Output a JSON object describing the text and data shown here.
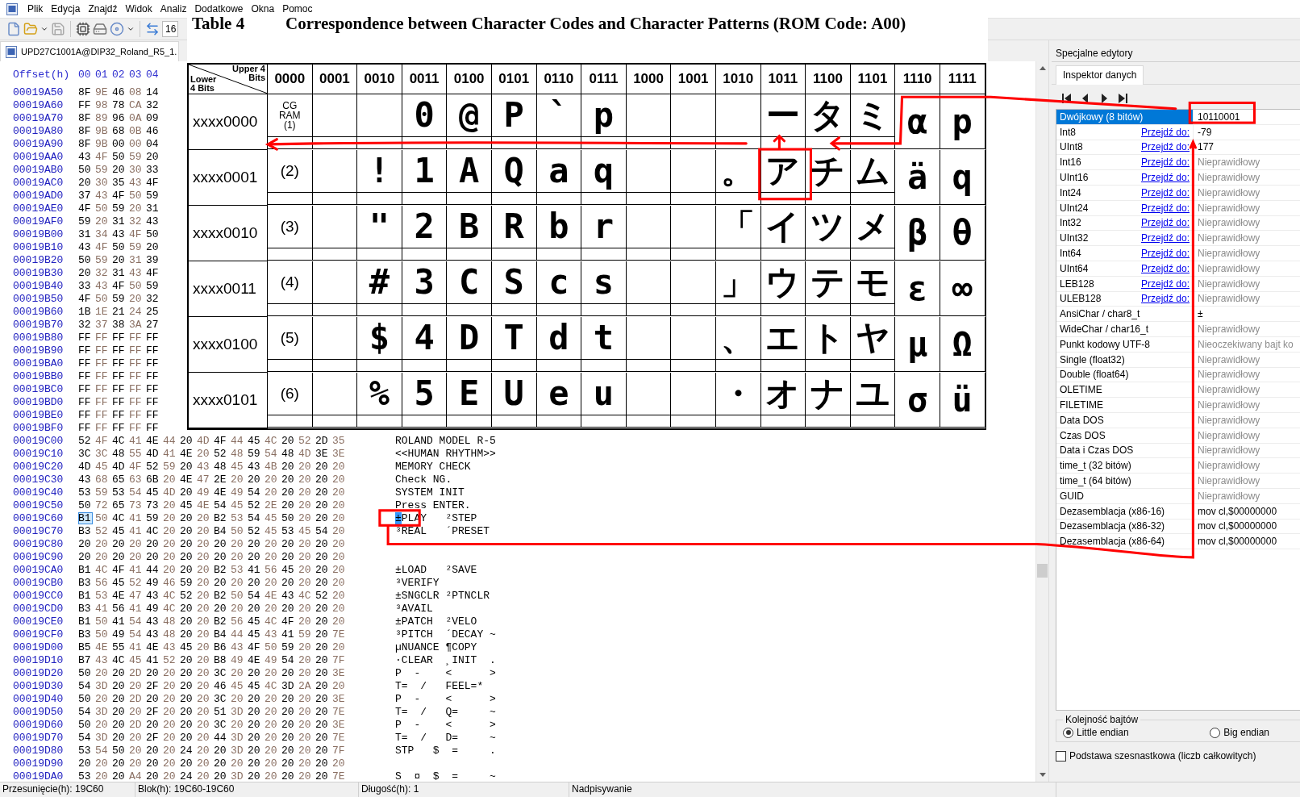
{
  "menu": [
    "Plik",
    "Edycja",
    "Znajdź",
    "Widok",
    "Analiz",
    "Dodatkowe",
    "Okna",
    "Pomoc"
  ],
  "toolbar": {
    "bytes_per_row": "16"
  },
  "file_tab": {
    "title": "UPD27C1001A@DIP32_Roland_R5_1."
  },
  "hex_view": {
    "offset_header": "Offset(h)",
    "columns": [
      "00",
      "01",
      "02",
      "03",
      "04"
    ],
    "rows": [
      {
        "offset": "00019A50",
        "bytes": "8F 9E 46 08 14",
        "selected": false
      },
      {
        "offset": "00019A60",
        "bytes": "FF 98 78 CA 32",
        "selected": false
      },
      {
        "offset": "00019A70",
        "bytes": "8F 89 96 0A 09",
        "selected": false
      },
      {
        "offset": "00019A80",
        "bytes": "8F 9B 68 0B 46",
        "selected": false
      },
      {
        "offset": "00019A90",
        "bytes": "8F 9B 00 00 04",
        "selected": false
      },
      {
        "offset": "00019AA0",
        "bytes": "43 4F 50 59 20",
        "selected": false
      },
      {
        "offset": "00019AB0",
        "bytes": "50 59 20 30 33",
        "selected": false
      },
      {
        "offset": "00019AC0",
        "bytes": "20 30 35 43 4F",
        "selected": false
      },
      {
        "offset": "00019AD0",
        "bytes": "37 43 4F 50 59",
        "selected": false
      },
      {
        "offset": "00019AE0",
        "bytes": "4F 50 59 20 31",
        "selected": false
      },
      {
        "offset": "00019AF0",
        "bytes": "59 20 31 32 43",
        "selected": false
      },
      {
        "offset": "00019B00",
        "bytes": "31 34 43 4F 50",
        "selected": false
      },
      {
        "offset": "00019B10",
        "bytes": "43 4F 50 59 20",
        "selected": false
      },
      {
        "offset": "00019B20",
        "bytes": "50 59 20 31 39",
        "selected": false
      },
      {
        "offset": "00019B30",
        "bytes": "20 32 31 43 4F",
        "selected": false
      },
      {
        "offset": "00019B40",
        "bytes": "33 43 4F 50 59",
        "selected": false
      },
      {
        "offset": "00019B50",
        "bytes": "4F 50 59 20 32",
        "selected": false
      },
      {
        "offset": "00019B60",
        "bytes": "1B 1E 21 24 25",
        "selected": false
      },
      {
        "offset": "00019B70",
        "bytes": "32 37 38 3A 27",
        "selected": false
      },
      {
        "offset": "00019B80",
        "bytes": "FF FF FF FF FF",
        "selected": false
      },
      {
        "offset": "00019B90",
        "bytes": "FF FF FF FF FF",
        "selected": false
      },
      {
        "offset": "00019BA0",
        "bytes": "FF FF FF FF FF",
        "selected": false
      },
      {
        "offset": "00019BB0",
        "bytes": "FF FF FF FF FF",
        "selected": false
      },
      {
        "offset": "00019BC0",
        "bytes": "FF FF FF FF FF",
        "selected": false
      },
      {
        "offset": "00019BD0",
        "bytes": "FF FF FF FF FF",
        "selected": false
      },
      {
        "offset": "00019BE0",
        "bytes": "FF FF FF FF FF",
        "selected": false
      },
      {
        "offset": "00019BF0",
        "bytes": "FF FF FF FF FF",
        "selected": false
      },
      {
        "offset": "00019C00",
        "bytes": "52 4F 4C 41 4E 44 20 4D 4F 44 45 4C 20 52 2D 35",
        "text": "ROLAND MODEL R-5",
        "selected": false
      },
      {
        "offset": "00019C10",
        "bytes": "3C 3C 48 55 4D 41 4E 20 52 48 59 54 48 4D 3E 3E",
        "text": "<<HUMAN RHYTHM>>",
        "selected": false
      },
      {
        "offset": "00019C20",
        "bytes": "4D 45 4D 4F 52 59 20 43 48 45 43 4B 20 20 20 20",
        "text": "MEMORY CHECK",
        "selected": false
      },
      {
        "offset": "00019C30",
        "bytes": "43 68 65 63 6B 20 4E 47 2E 20 20 20 20 20 20 20",
        "text": "Check NG.",
        "selected": false
      },
      {
        "offset": "00019C40",
        "bytes": "53 59 53 54 45 4D 20 49 4E 49 54 20 20 20 20 20",
        "text": "SYSTEM INIT",
        "selected": false
      },
      {
        "offset": "00019C50",
        "bytes": "50 72 65 73 73 20 45 4E 54 45 52 2E 20 20 20 20",
        "text": "Press ENTER.",
        "selected": false
      },
      {
        "offset": "00019C60",
        "bytes": "B1 50 4C 41 59 20 20 20 B2 53 54 45 50 20 20 20",
        "text": "±PLAY   ²STEP",
        "selected": true
      },
      {
        "offset": "00019C70",
        "bytes": "B3 52 45 41 4C 20 20 20 B4 50 52 45 53 45 54 20",
        "text": "³REAL   ´PRESET",
        "selected": false
      },
      {
        "offset": "00019C80",
        "bytes": "20 20 20 20 20 20 20 20 20 20 20 20 20 20 20 20",
        "selected": false
      },
      {
        "offset": "00019C90",
        "bytes": "20 20 20 20 20 20 20 20 20 20 20 20 20 20 20 20",
        "selected": false
      },
      {
        "offset": "00019CA0",
        "bytes": "B1 4C 4F 41 44 20 20 20 B2 53 41 56 45 20 20 20",
        "text": "±LOAD   ²SAVE",
        "selected": false
      },
      {
        "offset": "00019CB0",
        "bytes": "B3 56 45 52 49 46 59 20 20 20 20 20 20 20 20 20",
        "text": "³VERIFY",
        "selected": false
      },
      {
        "offset": "00019CC0",
        "bytes": "B1 53 4E 47 43 4C 52 20 B2 50 54 4E 43 4C 52 20",
        "text": "±SNGCLR ²PTNCLR",
        "selected": false
      },
      {
        "offset": "00019CD0",
        "bytes": "B3 41 56 41 49 4C 20 20 20 20 20 20 20 20 20 20",
        "text": "³AVAIL",
        "selected": false
      },
      {
        "offset": "00019CE0",
        "bytes": "B1 50 41 54 43 48 20 20 B2 56 45 4C 4F 20 20 20",
        "text": "±PATCH  ²VELO",
        "selected": false
      },
      {
        "offset": "00019CF0",
        "bytes": "B3 50 49 54 43 48 20 20 B4 44 45 43 41 59 20 7E",
        "text": "³PITCH  ´DECAY ~",
        "selected": false
      },
      {
        "offset": "00019D00",
        "bytes": "B5 4E 55 41 4E 43 45 20 B6 43 4F 50 59 20 20 20",
        "text": "µNUANCE ¶COPY",
        "selected": false
      },
      {
        "offset": "00019D10",
        "bytes": "B7 43 4C 45 41 52 20 20 B8 49 4E 49 54 20 20 7F",
        "text": "·CLEAR  ¸INIT  .",
        "selected": false
      },
      {
        "offset": "00019D20",
        "bytes": "50 20 20 2D 20 20 20 20 3C 20 20 20 20 20 20 3E",
        "text": "P  -    <      >",
        "selected": false
      },
      {
        "offset": "00019D30",
        "bytes": "54 3D 20 20 2F 20 20 20 46 45 45 4C 3D 2A 20 20",
        "text": "T=  /   FEEL=*",
        "selected": false
      },
      {
        "offset": "00019D40",
        "bytes": "50 20 20 2D 20 20 20 20 3C 20 20 20 20 20 20 3E",
        "text": "P  -    <      >",
        "selected": false
      },
      {
        "offset": "00019D50",
        "bytes": "54 3D 20 20 2F 20 20 20 51 3D 20 20 20 20 20 7E",
        "text": "T=  /   Q=     ~",
        "selected": false
      },
      {
        "offset": "00019D60",
        "bytes": "50 20 20 2D 20 20 20 20 3C 20 20 20 20 20 20 3E",
        "text": "P  -    <      >",
        "selected": false
      },
      {
        "offset": "00019D70",
        "bytes": "54 3D 20 20 2F 20 20 20 44 3D 20 20 20 20 20 7E",
        "text": "T=  /   D=     ~",
        "selected": false
      },
      {
        "offset": "00019D80",
        "bytes": "53 54 50 20 20 20 24 20 20 3D 20 20 20 20 20 7F",
        "text": "STP   $  =     .",
        "selected": false
      },
      {
        "offset": "00019D90",
        "bytes": "20 20 20 20 20 20 20 20 20 20 20 20 20 20 20 20",
        "selected": false
      },
      {
        "offset": "00019DA0",
        "bytes": "53 20 20 A4 20 20 24 20 20 3D 20 20 20 20 20 7E",
        "text": "S  ¤  $  =     ~",
        "selected": false
      }
    ]
  },
  "pasted_table": {
    "table_label": "Table 4",
    "title": "Correspondence between Character Codes and Character Patterns (ROM Code: A00)",
    "corner_upper": "Upper 4 Bits",
    "corner_lower": "Lower 4 Bits",
    "columns": [
      "0000",
      "0001",
      "0010",
      "0011",
      "0100",
      "0101",
      "0110",
      "0111",
      "1000",
      "1001",
      "1010",
      "1011",
      "1100",
      "1101",
      "1110",
      "1111"
    ],
    "rows": [
      {
        "label": "xxxx0000",
        "cells": [
          "CG RAM (1)",
          null,
          null,
          "0",
          "@",
          "P",
          "`",
          "p",
          null,
          null,
          null,
          "ー",
          "タ",
          "ミ",
          "α",
          "p"
        ]
      },
      {
        "label": "xxxx0001",
        "cells": [
          "(2)",
          null,
          "!",
          "1",
          "A",
          "Q",
          "a",
          "q",
          null,
          null,
          "。",
          "ア",
          "チ",
          "ム",
          "ä",
          "q"
        ]
      },
      {
        "label": "xxxx0010",
        "cells": [
          "(3)",
          null,
          "\"",
          "2",
          "B",
          "R",
          "b",
          "r",
          null,
          null,
          "「",
          "イ",
          "ツ",
          "メ",
          "β",
          "θ"
        ]
      },
      {
        "label": "xxxx0011",
        "cells": [
          "(4)",
          null,
          "#",
          "3",
          "C",
          "S",
          "c",
          "s",
          null,
          null,
          "」",
          "ウ",
          "テ",
          "モ",
          "ε",
          "∞"
        ]
      },
      {
        "label": "xxxx0100",
        "cells": [
          "(5)",
          null,
          "$",
          "4",
          "D",
          "T",
          "d",
          "t",
          null,
          null,
          "、",
          "エ",
          "ト",
          "ヤ",
          "μ",
          "Ω"
        ]
      },
      {
        "label": "xxxx0101",
        "cells": [
          "(6)",
          null,
          "%",
          "5",
          "E",
          "U",
          "e",
          "u",
          null,
          null,
          "・",
          "オ",
          "ナ",
          "ユ",
          "σ",
          "ü"
        ]
      }
    ]
  },
  "inspector": {
    "panel_title": "Specjalne edytory",
    "tabs": [
      {
        "label": "Inspektor danych",
        "selected": true
      }
    ],
    "rows": [
      {
        "label": "Dwójkowy (8 bitów)",
        "value": "10110001",
        "valid": true,
        "selected": true
      },
      {
        "label": "Int8",
        "link": "Przejdź do:",
        "value": "-79",
        "valid": true,
        "selected": false
      },
      {
        "label": "UInt8",
        "link": "Przejdź do:",
        "value": "177",
        "valid": true,
        "selected": false
      },
      {
        "label": "Int16",
        "link": "Przejdź do:",
        "value": "Nieprawidłowy",
        "valid": false,
        "selected": false
      },
      {
        "label": "UInt16",
        "link": "Przejdź do:",
        "value": "Nieprawidłowy",
        "valid": false,
        "selected": false
      },
      {
        "label": "Int24",
        "link": "Przejdź do:",
        "value": "Nieprawidłowy",
        "valid": false,
        "selected": false
      },
      {
        "label": "UInt24",
        "link": "Przejdź do:",
        "value": "Nieprawidłowy",
        "valid": false,
        "selected": false
      },
      {
        "label": "Int32",
        "link": "Przejdź do:",
        "value": "Nieprawidłowy",
        "valid": false,
        "selected": false
      },
      {
        "label": "UInt32",
        "link": "Przejdź do:",
        "value": "Nieprawidłowy",
        "valid": false,
        "selected": false
      },
      {
        "label": "Int64",
        "link": "Przejdź do:",
        "value": "Nieprawidłowy",
        "valid": false,
        "selected": false
      },
      {
        "label": "UInt64",
        "link": "Przejdź do:",
        "value": "Nieprawidłowy",
        "valid": false,
        "selected": false
      },
      {
        "label": "LEB128",
        "link": "Przejdź do:",
        "value": "Nieprawidłowy",
        "valid": false,
        "selected": false
      },
      {
        "label": "ULEB128",
        "link": "Przejdź do:",
        "value": "Nieprawidłowy",
        "valid": false,
        "selected": false
      },
      {
        "label": "AnsiChar / char8_t",
        "value": "±",
        "valid": true,
        "selected": false
      },
      {
        "label": "WideChar / char16_t",
        "value": "Nieprawidłowy",
        "valid": false,
        "selected": false
      },
      {
        "label": "Punkt kodowy UTF-8",
        "value": "Nieoczekiwany bajt ko",
        "valid": false,
        "selected": false
      },
      {
        "label": "Single (float32)",
        "value": "Nieprawidłowy",
        "valid": false,
        "selected": false
      },
      {
        "label": "Double (float64)",
        "value": "Nieprawidłowy",
        "valid": false,
        "selected": false
      },
      {
        "label": "OLETIME",
        "value": "Nieprawidłowy",
        "valid": false,
        "selected": false
      },
      {
        "label": "FILETIME",
        "value": "Nieprawidłowy",
        "valid": false,
        "selected": false
      },
      {
        "label": "Data DOS",
        "value": "Nieprawidłowy",
        "valid": false,
        "selected": false
      },
      {
        "label": "Czas DOS",
        "value": "Nieprawidłowy",
        "valid": false,
        "selected": false
      },
      {
        "label": "Data i Czas DOS",
        "value": "Nieprawidłowy",
        "valid": false,
        "selected": false
      },
      {
        "label": "time_t (32 bitów)",
        "value": "Nieprawidłowy",
        "valid": false,
        "selected": false
      },
      {
        "label": "time_t (64 bitów)",
        "value": "Nieprawidłowy",
        "valid": false,
        "selected": false
      },
      {
        "label": "GUID",
        "value": "Nieprawidłowy",
        "valid": false,
        "selected": false
      },
      {
        "label": "Dezasemblacja (x86-16)",
        "value": "mov cl,$00000000",
        "valid": true,
        "selected": false
      },
      {
        "label": "Dezasemblacja (x86-32)",
        "value": "mov cl,$00000000",
        "valid": true,
        "selected": false
      },
      {
        "label": "Dezasemblacja (x86-64)",
        "value": "mov cl,$00000000",
        "valid": true,
        "selected": false
      }
    ],
    "byte_order": {
      "title": "Kolejność bajtów",
      "options": [
        {
          "label": "Little endian",
          "selected": true
        },
        {
          "label": "Big endian",
          "selected": false
        }
      ]
    },
    "hex_base": {
      "label": "Podstawa szesnastkowa (liczb całkowitych)",
      "checked": false
    }
  },
  "status_bar": [
    "Przesunięcie(h): 19C60",
    "Blok(h): 19C60-19C60",
    "Długość(h): 1",
    "Nadpisywanie"
  ]
}
